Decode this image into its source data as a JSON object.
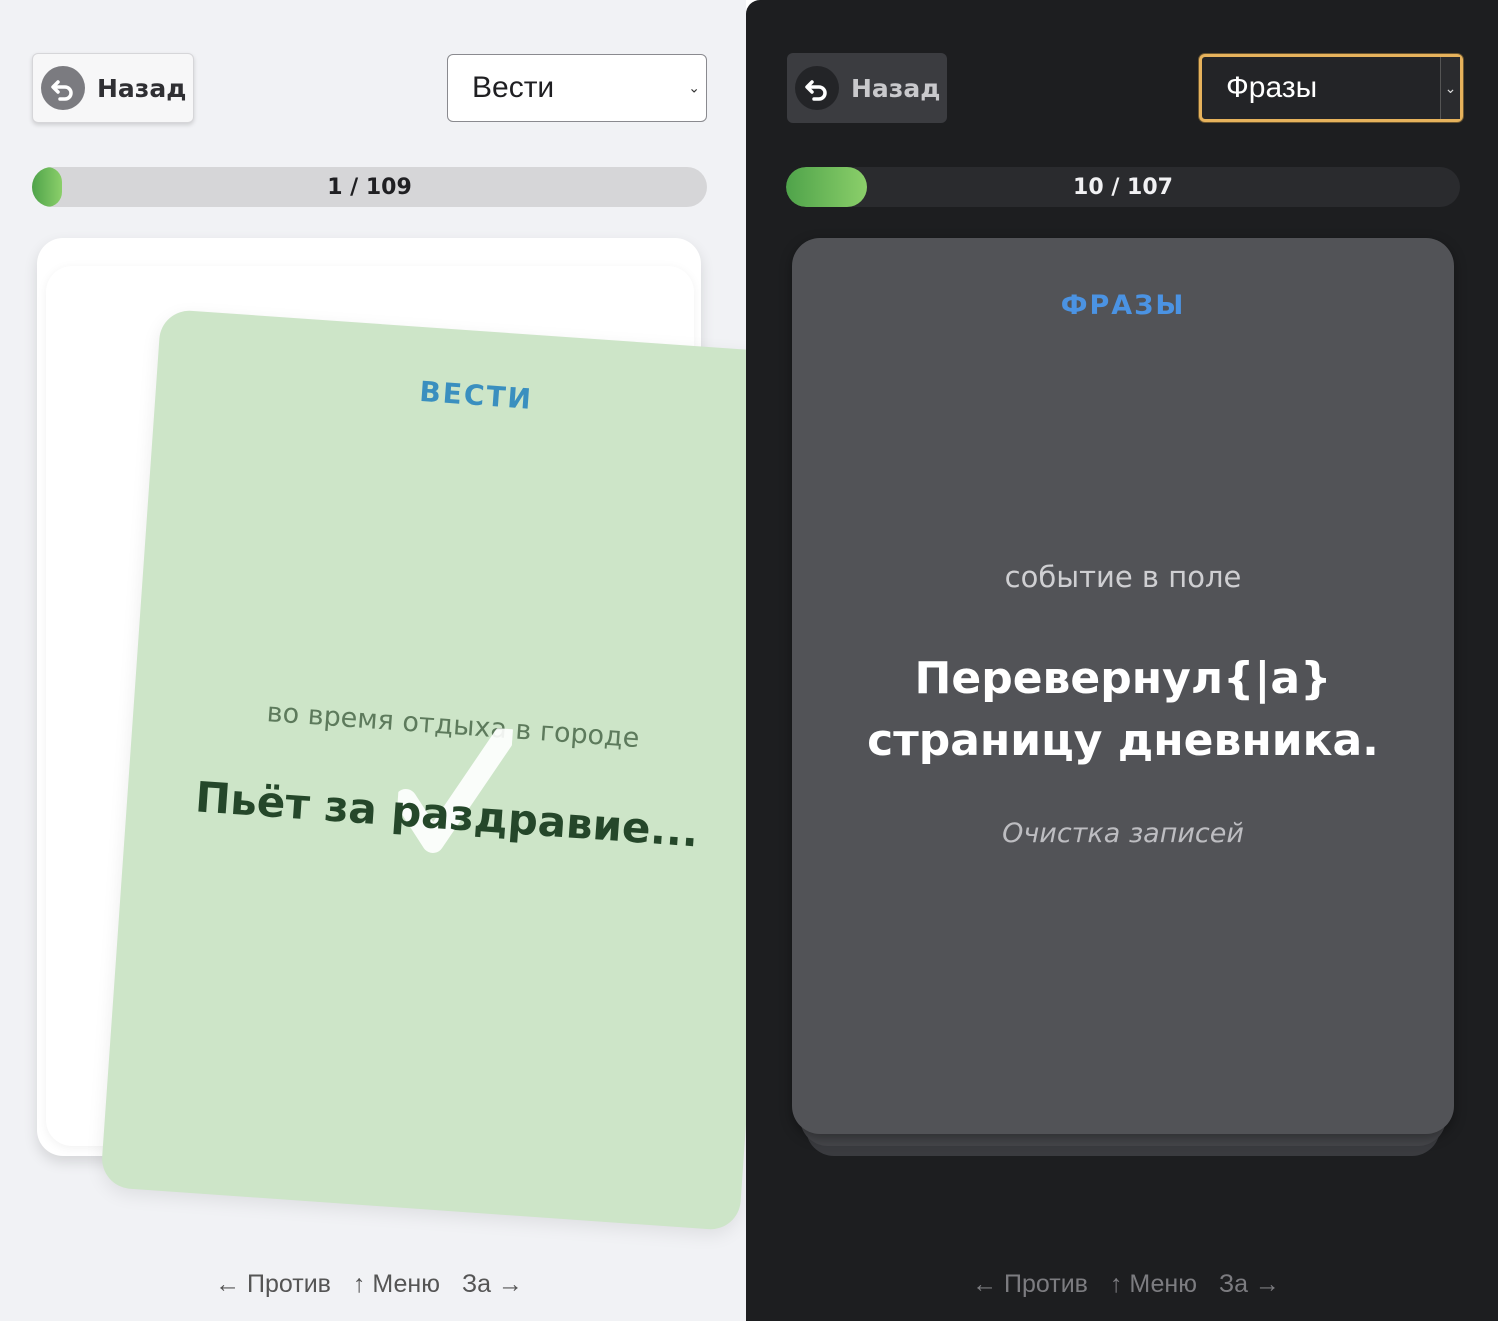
{
  "light_panel": {
    "back_label": "Назад",
    "deck_selected": "Вести",
    "progress_text": "1 / 109",
    "progress_fraction": 0.009,
    "card": {
      "category": "ВЕСТИ",
      "context": "во время отдыха в городе",
      "phrase": "Пьёт за раздравие..."
    },
    "hints": {
      "against": "← Против",
      "menu": "↑ Меню",
      "for": "За →"
    },
    "colors": {
      "background": "#f1f2f5",
      "card": "#cde5c8",
      "category": "#3a8fbf",
      "phrase": "#25472a"
    }
  },
  "dark_panel": {
    "back_label": "Назад",
    "deck_selected": "Фразы",
    "progress_text": "10 / 107",
    "progress_fraction": 0.093,
    "card": {
      "category": "ФРАЗЫ",
      "context": "событие в поле",
      "phrase": "Перевернул{|а} страницу дневника.",
      "note": "Очистка записей"
    },
    "hints": {
      "against": "← Против",
      "menu": "↑ Меню",
      "for": "За →"
    },
    "colors": {
      "background": "#1d1e20",
      "card": "#525357",
      "category": "#4b93e3",
      "select_border": "#e6b25c"
    }
  },
  "icons": {
    "back": "undo-arrow-icon",
    "select": "chevron-down-icon",
    "swipe_right": "checkmark-icon"
  }
}
